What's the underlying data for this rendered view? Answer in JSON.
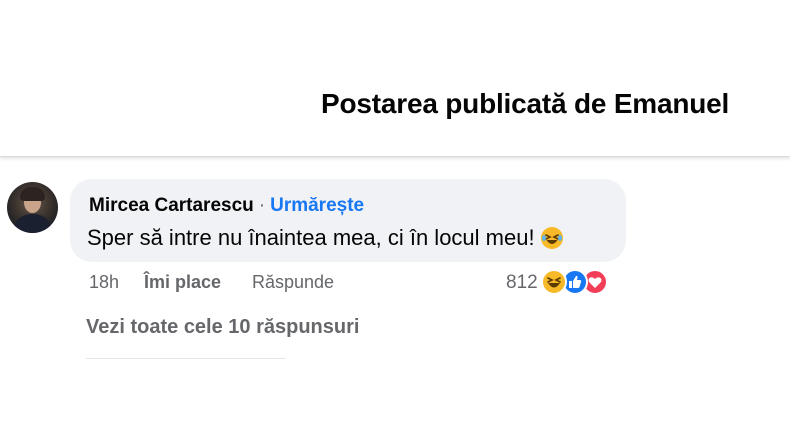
{
  "header": {
    "title": "Postarea publicată de Emanuel"
  },
  "comment": {
    "author": "Mircea Cartarescu",
    "separator": "·",
    "follow_label": "Urmărește",
    "text": "Sper să intre nu înaintea mea, ci în locul meu!",
    "text_emoji": "laughing-crying-emoji",
    "time": "18h",
    "like_label": "Îmi place",
    "reply_label": "Răspunde",
    "reaction_count": "812",
    "reactions": [
      "haha",
      "like",
      "love"
    ]
  },
  "replies": {
    "view_label": "Vezi toate cele 10 răspunsuri"
  },
  "colors": {
    "accent": "#1877f2",
    "bubble": "#f0f2f5",
    "secondary_text": "#65676b",
    "love": "#f33e58",
    "haha": "#f7b928"
  }
}
